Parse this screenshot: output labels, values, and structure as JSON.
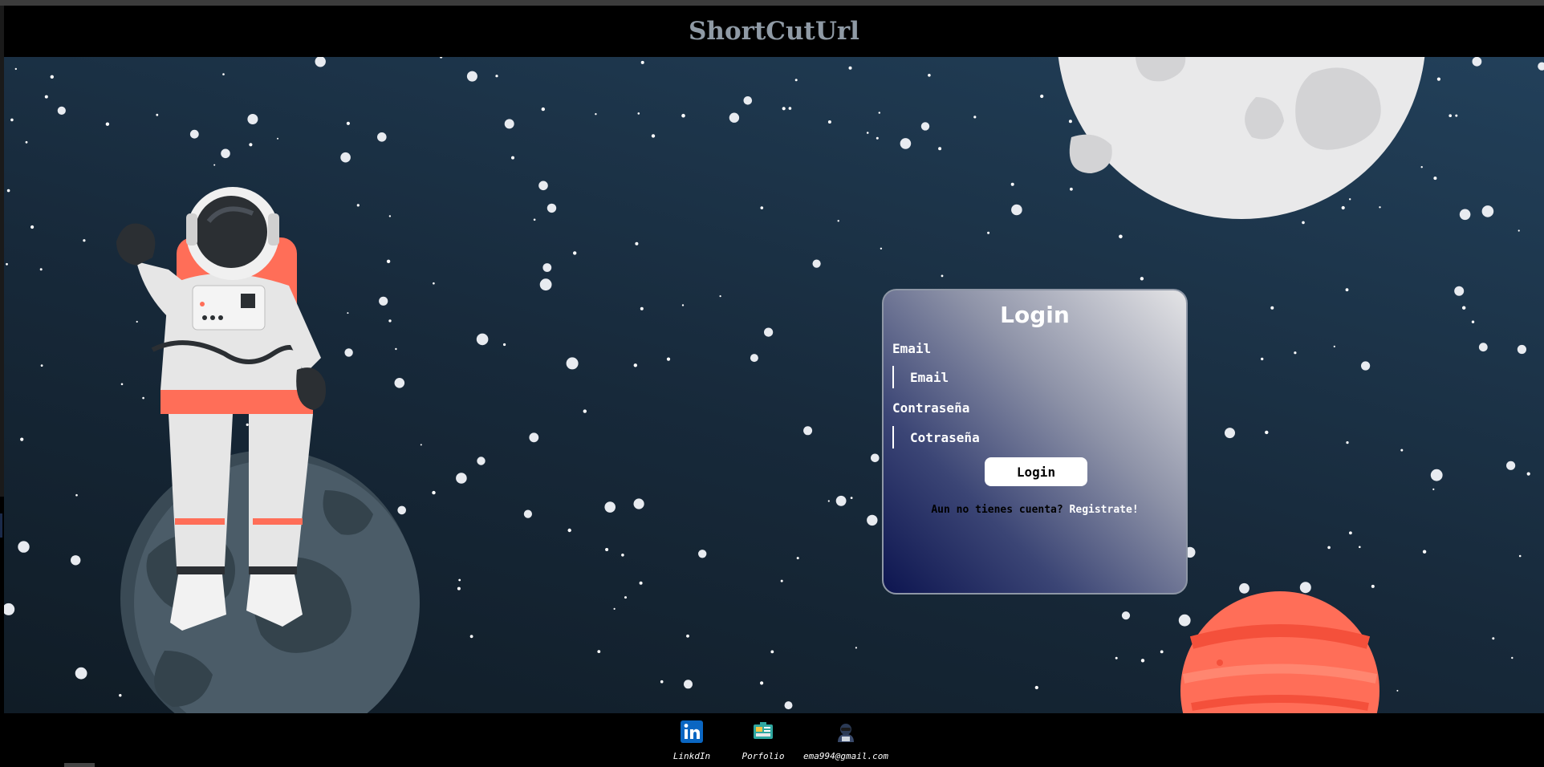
{
  "header": {
    "brand": "ShortCutUrl"
  },
  "login": {
    "title": "Login",
    "email_label": "Email",
    "email_placeholder": "Email",
    "password_label": "Contraseña",
    "password_placeholder": "Cotraseña",
    "submit_label": "Login",
    "register_prompt": "Aun no tienes cuenta?",
    "register_link": "Registrate!"
  },
  "footer": {
    "links": [
      {
        "label": "LinkdIn",
        "icon": "linkedin-icon"
      },
      {
        "label": "Porfolio",
        "icon": "portfolio-icon"
      },
      {
        "label": "ema994@gmail.com",
        "icon": "hacker-icon"
      }
    ]
  },
  "colors": {
    "background_top": "#22405a",
    "background_bottom": "#101c26",
    "brand_text": "#8f9aa5",
    "card_gradient_start": "#0d1550",
    "card_gradient_end": "#e4e4e6",
    "accent_red": "#ff6e58",
    "linkedin_blue": "#0a66c2"
  }
}
